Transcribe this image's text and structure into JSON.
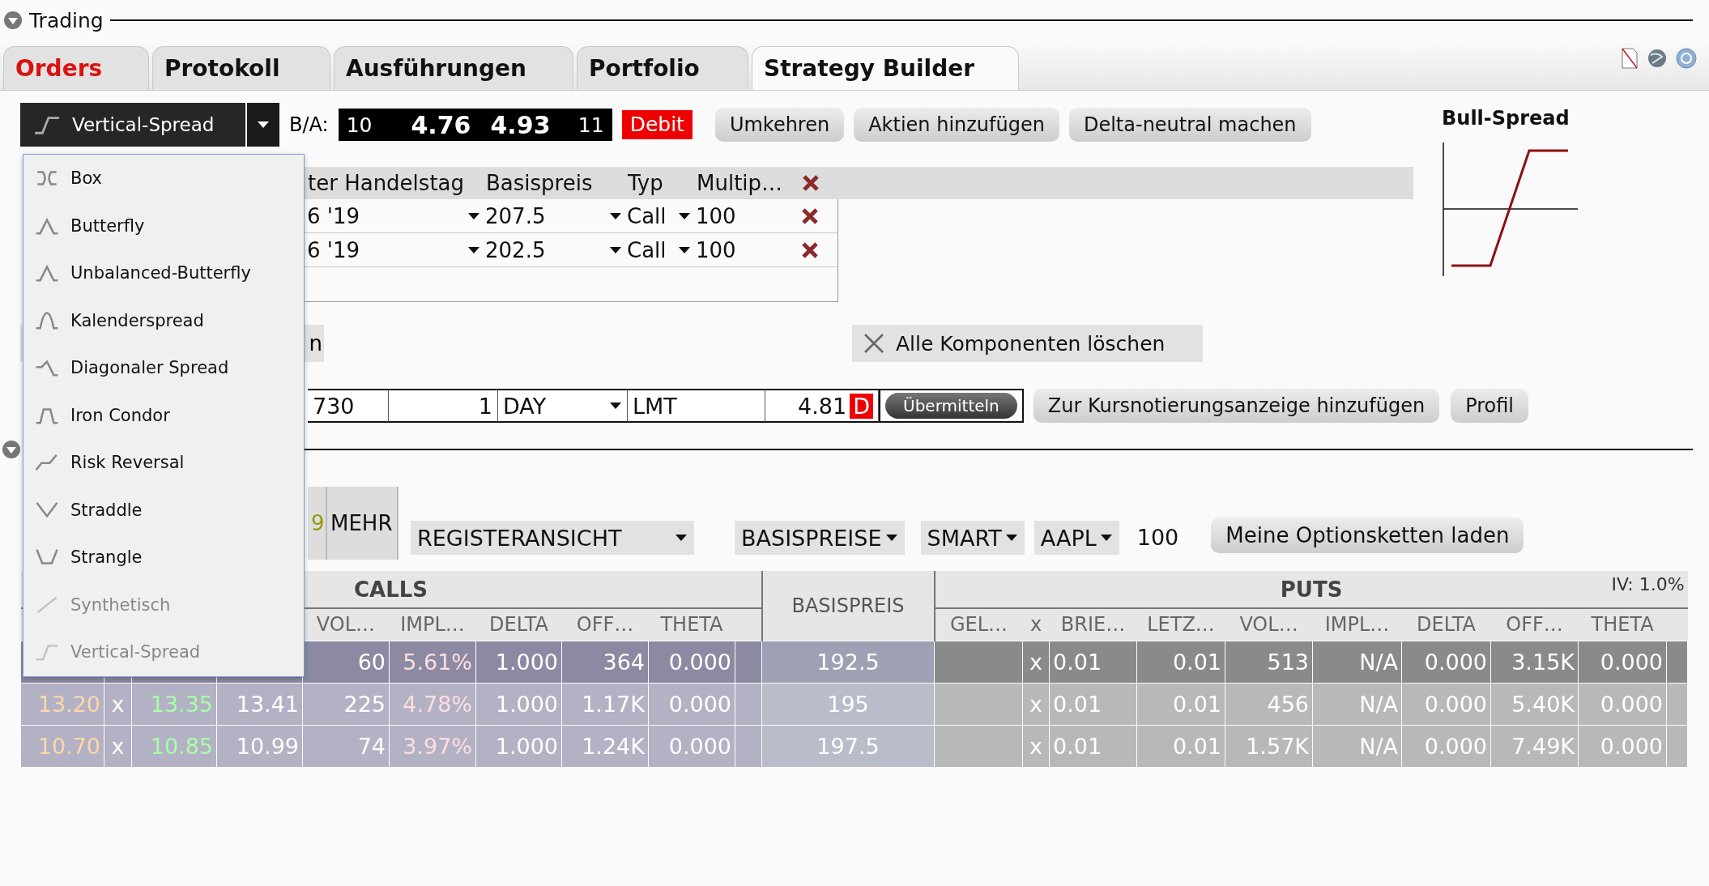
{
  "section_title": "Trading",
  "tabs": [
    {
      "label": "Orders",
      "selected": false,
      "color": "#dd1111"
    },
    {
      "label": "Protokoll",
      "selected": false,
      "color": "#111111"
    },
    {
      "label": "Ausführungen",
      "selected": false,
      "color": "#111111"
    },
    {
      "label": "Portfolio",
      "selected": false,
      "color": "#111111"
    },
    {
      "label": "Strategy Builder",
      "selected": true,
      "color": "#111111"
    }
  ],
  "strategy": {
    "value": "Vertical-Spread"
  },
  "quote": {
    "label": "B/A:",
    "bid_size": "10",
    "bid": "4.76",
    "ask": "4.93",
    "ask_size": "11",
    "badge": "Debit"
  },
  "actions": [
    "Umkehren",
    "Aktien hinzufügen",
    "Delta-neutral machen"
  ],
  "strategy_menu": [
    {
      "label": "Box",
      "disabled": false
    },
    {
      "label": "Butterfly",
      "disabled": false
    },
    {
      "label": "Unbalanced-Butterfly",
      "disabled": false
    },
    {
      "label": "Kalenderspread",
      "disabled": false
    },
    {
      "label": "Diagonaler Spread",
      "disabled": false
    },
    {
      "label": "Iron Condor",
      "disabled": false
    },
    {
      "label": "Risk Reversal",
      "disabled": false
    },
    {
      "label": "Straddle",
      "disabled": false
    },
    {
      "label": "Strangle",
      "disabled": false
    },
    {
      "label": "Synthetisch",
      "disabled": true
    },
    {
      "label": "Vertical-Spread",
      "disabled": true
    }
  ],
  "legs": {
    "columns": [
      "ter Handelstag",
      "Basispreis",
      "Typ",
      "Multip…"
    ],
    "rows": [
      {
        "expiry": "6 '19",
        "strike": "207.5",
        "type": "Call",
        "multiplier": "100"
      },
      {
        "expiry": "6 '19",
        "strike": "202.5",
        "type": "Call",
        "multiplier": "100"
      }
    ]
  },
  "payoff": {
    "title": "Bull-Spread"
  },
  "partial_button": "n",
  "clear_button": "Alle Komponenten löschen",
  "order": {
    "account": "730",
    "quantity": "1",
    "tif": "DAY",
    "type": "LMT",
    "price": "4.81",
    "price_flag": "D",
    "submit": "Übermitteln"
  },
  "order_actions": [
    "Zur Kursnotierungsanzeige hinzufügen",
    "Profil"
  ],
  "chain_toolbar": {
    "tabs": [
      {
        "label": "9",
        "color": "#999900"
      },
      {
        "label": "MEHR",
        "color": "#111111"
      }
    ],
    "view": "REGISTERANSICHT",
    "strikes": "BASISPREISE",
    "exchange": "SMART",
    "symbol": "AAPL",
    "multiplier": "100",
    "load_button": "Meine Optionsketten laden"
  },
  "chain": {
    "calls_title": "CALLS",
    "strike_title": "BASISPREIS",
    "puts_title": "PUTS",
    "iv": "IV: 1.0%",
    "call_columns": [
      "VOL…",
      "IMPL…",
      "DELTA",
      "OFF…",
      "THETA"
    ],
    "put_columns": [
      "GEL…",
      "x",
      "BRIE…",
      "LETZ…",
      "VOL…",
      "IMPL…",
      "DELTA",
      "OFF…",
      "THETA"
    ],
    "rows": [
      {
        "selected": true,
        "calls": {
          "vol": "60",
          "impl": "5.61%",
          "delta": "1.000",
          "off": "364",
          "theta": "0.000"
        },
        "strike": "192.5",
        "puts": {
          "x": "x",
          "bid": "0.01",
          "last": "0.01",
          "vol": "513",
          "impl": "N/A",
          "delta": "0.000",
          "off": "3.15K",
          "theta": "0.000"
        }
      },
      {
        "selected": false,
        "calls": {
          "bid": "13.20",
          "x": "x",
          "ask": "13.35",
          "last": "13.41",
          "vol": "225",
          "impl": "4.78%",
          "delta": "1.000",
          "off": "1.17K",
          "theta": "0.000"
        },
        "strike": "195",
        "puts": {
          "x": "x",
          "bid": "0.01",
          "last": "0.01",
          "vol": "456",
          "impl": "N/A",
          "delta": "0.000",
          "off": "5.40K",
          "theta": "0.000"
        }
      },
      {
        "selected": false,
        "calls": {
          "bid": "10.70",
          "x": "x",
          "ask": "10.85",
          "last": "10.99",
          "vol": "74",
          "impl": "3.97%",
          "delta": "1.000",
          "off": "1.24K",
          "theta": "0.000"
        },
        "strike": "197.5",
        "puts": {
          "x": "x",
          "bid": "0.01",
          "last": "0.01",
          "vol": "1.57K",
          "impl": "N/A",
          "delta": "0.000",
          "off": "7.49K",
          "theta": "0.000"
        }
      }
    ]
  }
}
